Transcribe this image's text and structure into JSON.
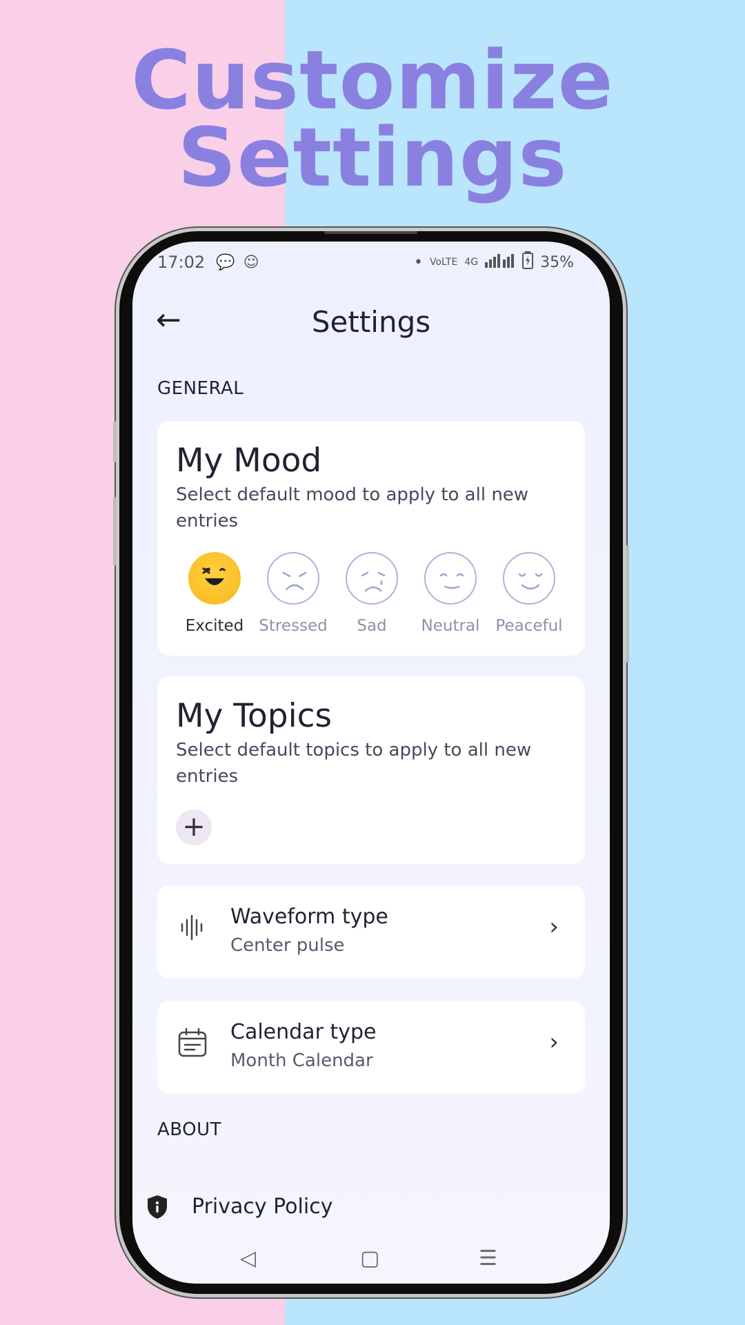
{
  "headline": {
    "line1": "Customize",
    "line2": "Settings"
  },
  "status": {
    "time": "17:02",
    "battery": "35%",
    "network": "4G"
  },
  "appbar": {
    "title": "Settings"
  },
  "sections": {
    "general": "GENERAL",
    "about": "ABOUT"
  },
  "mood": {
    "title": "My Mood",
    "subtitle": "Select default mood to apply to all new entries",
    "options": [
      "Excited",
      "Stressed",
      "Sad",
      "Neutral",
      "Peaceful"
    ],
    "selected": "Excited"
  },
  "topics": {
    "title": "My Topics",
    "subtitle": "Select default topics to apply to all new entries",
    "add": "+"
  },
  "waveform": {
    "title": "Waveform type",
    "value": "Center pulse"
  },
  "calendar": {
    "title": "Calendar type",
    "value": "Month Calendar"
  },
  "privacy": {
    "label": "Privacy Policy"
  },
  "colors": {
    "headline": "#8a80e0",
    "left_bg": "#f9d0e8",
    "right_bg": "#bae6fd",
    "selected_mood": "#f7b91c"
  }
}
